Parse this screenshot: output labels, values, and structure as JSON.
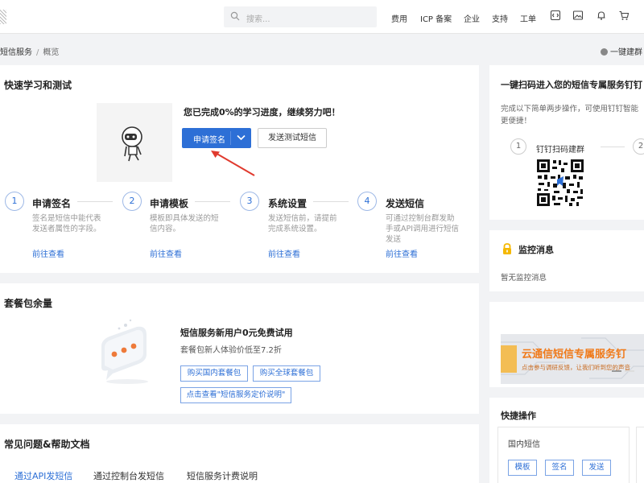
{
  "topbar": {
    "search_placeholder": "搜索...",
    "nav": [
      "费用",
      "ICP 备案",
      "企业",
      "支持",
      "工单"
    ],
    "icons": [
      "code-icon",
      "image-icon",
      "bell-icon",
      "cart-icon"
    ]
  },
  "breadcrumb": {
    "service": "短信服务",
    "separator": "/",
    "current": "概览",
    "action": "一键建群"
  },
  "quickstart": {
    "title": "快速学习和测试",
    "progress": "您已完成0%的学习进度，继续努力吧！",
    "primary_button": "申请签名",
    "secondary_button": "发送测试短信",
    "steps": [
      {
        "num": "1",
        "title": "申请签名",
        "desc1": "签名是短信中能代表",
        "desc2": "发送者属性的字段。",
        "desc3": "",
        "link": "前往查看"
      },
      {
        "num": "2",
        "title": "申请模板",
        "desc1": "模板即具体发送的短",
        "desc2": "信内容。",
        "desc3": "",
        "link": "前往查看"
      },
      {
        "num": "3",
        "title": "系统设置",
        "desc1": "发送短信前，请提前",
        "desc2": "完成系统设置。",
        "desc3": "",
        "link": "前往查看"
      },
      {
        "num": "4",
        "title": "发送短信",
        "desc1": "可通过控制台群发助",
        "desc2": "手或API调用进行短信",
        "desc3": "发送",
        "link": "前往查看"
      }
    ]
  },
  "package": {
    "title": "套餐包余量",
    "promo_title": "短信服务新用户0元免费试用",
    "promo_sub": "套餐包新人体验价低至7.2折",
    "btn_domestic": "购买国内套餐包",
    "btn_global": "购买全球套餐包",
    "btn_pricing": "点击查看\"短信服务定价说明\""
  },
  "faq": {
    "title": "常见问题&帮助文档",
    "tabs": [
      "通过API发短信",
      "通过控制台发短信",
      "短信服务计费说明"
    ],
    "active_tab": 0
  },
  "dingtalk": {
    "title": "一键扫码进入您的短信专属服务钉钉",
    "desc1": "完成以下简单两步操作，可使用钉钉智能",
    "desc2": "更便捷！",
    "step1_num": "1",
    "step1_label": "钉钉扫码建群",
    "step2_num": "2"
  },
  "monitor": {
    "title": "监控消息",
    "empty": "暂无监控消息"
  },
  "banner": {
    "title": "云通信短信专属服务钉",
    "subtitle": "点击参与调研反馈，让我们听到您的声音"
  },
  "quick_ops": {
    "title": "快捷操作",
    "section": "国内短信",
    "buttons": [
      "模板",
      "签名",
      "发送"
    ]
  },
  "colors": {
    "primary": "#2d6fd6",
    "arrow": "#e03a2e",
    "banner_text": "#f07a1a",
    "monitor_icon": "#f5b800",
    "dot_accent": "#ee7a3a"
  }
}
